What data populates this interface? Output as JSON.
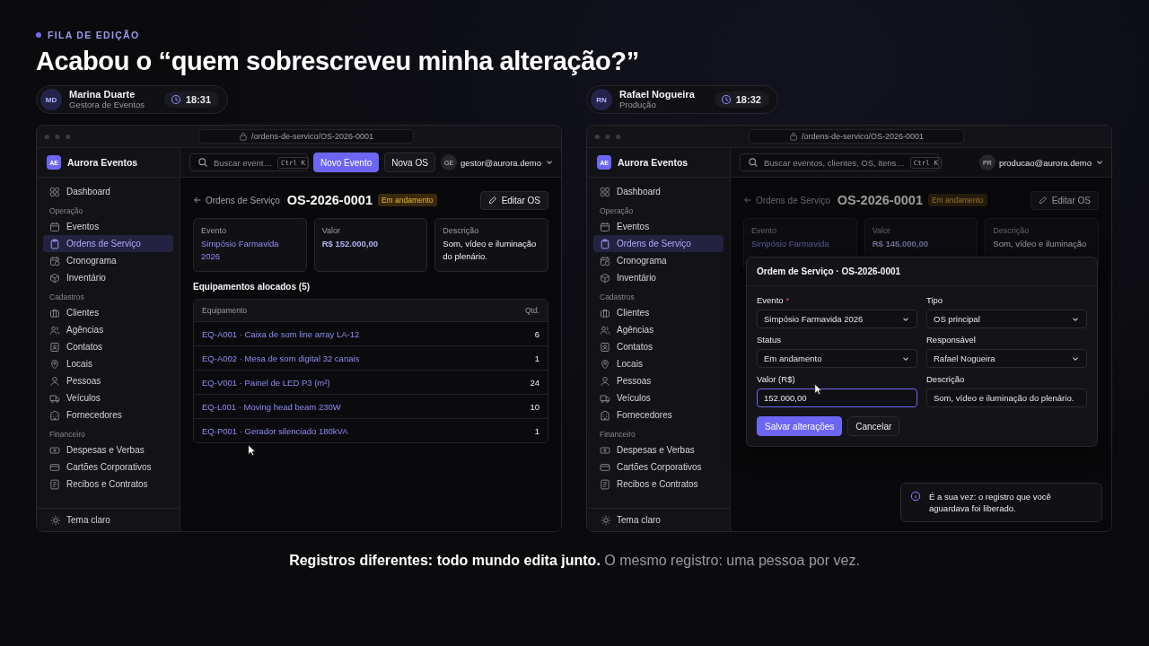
{
  "eyebrow": "FILA DE EDIÇÃO",
  "title": "Acabou o “quem sobrescreveu minha alteração?”",
  "panels": [
    {
      "user": {
        "initials": "MD",
        "name": "Marina Duarte",
        "role": "Gestora de Eventos",
        "time": "18:31"
      },
      "window": {
        "url": "/ordens-de-servico/OS-2026-0001",
        "brand_initials": "AE",
        "brand": "Aurora Eventos",
        "sidebar": [
          {
            "kind": "item",
            "label": "Dashboard",
            "selected": false
          },
          {
            "kind": "group",
            "label": "Operação"
          },
          {
            "kind": "item",
            "label": "Eventos",
            "selected": false
          },
          {
            "kind": "item",
            "label": "Ordens de Serviço",
            "selected": true
          },
          {
            "kind": "item",
            "label": "Cronograma",
            "selected": false
          },
          {
            "kind": "item",
            "label": "Inventário",
            "selected": false
          },
          {
            "kind": "group",
            "label": "Cadastros"
          },
          {
            "kind": "item",
            "label": "Clientes",
            "selected": false
          },
          {
            "kind": "item",
            "label": "Agências",
            "selected": false
          },
          {
            "kind": "item",
            "label": "Contatos",
            "selected": false
          },
          {
            "kind": "item",
            "label": "Locais",
            "selected": false
          },
          {
            "kind": "item",
            "label": "Pessoas",
            "selected": false
          },
          {
            "kind": "item",
            "label": "Veículos",
            "selected": false
          },
          {
            "kind": "item",
            "label": "Fornecedores",
            "selected": false
          },
          {
            "kind": "group",
            "label": "Financeiro"
          },
          {
            "kind": "item",
            "label": "Despesas e Verbas",
            "selected": false
          },
          {
            "kind": "item",
            "label": "Cartões Corporativos",
            "selected": false
          },
          {
            "kind": "item",
            "label": "Recibos e Contratos",
            "selected": false
          }
        ],
        "sidebar_footer": "Tema claro",
        "search": {
          "placeholder": "Buscar event…",
          "shortcut": "Ctrl K"
        },
        "actions": [
          {
            "label": "Novo Evento",
            "primary": true
          },
          {
            "label": "Nova OS",
            "primary": false
          }
        ],
        "account": {
          "initials": "GE",
          "email": "gestor@aurora.demo"
        },
        "page": {
          "back": "Ordens de Serviço",
          "title": "OS-2026-0001",
          "status": "Em andamento",
          "edit": "Editar OS",
          "cards": [
            {
              "label": "Evento",
              "value": "Simpósio Farmavida 2026",
              "kind": "link"
            },
            {
              "label": "Valor",
              "value": "R$ 152.000,00",
              "kind": "amount"
            },
            {
              "label": "Descrição",
              "value": "Som, vídeo e iluminação do plenário.",
              "kind": "text"
            }
          ],
          "equipment": {
            "title": "Equipamentos alocados (5)",
            "columns": [
              "Equipamento",
              "Qtd."
            ],
            "rows": [
              {
                "item": "EQ-A001 · Caixa de som line array LA-12",
                "qty": "6"
              },
              {
                "item": "EQ-A002 · Mesa de som digital 32 canais",
                "qty": "1"
              },
              {
                "item": "EQ-V001 · Painel de LED P3 (m²)",
                "qty": "24"
              },
              {
                "item": "EQ-L001 · Moving head beam 230W",
                "qty": "10"
              },
              {
                "item": "EQ-P001 · Gerador silenciado 180kVA",
                "qty": "1"
              }
            ]
          }
        }
      }
    },
    {
      "user": {
        "initials": "RN",
        "name": "Rafael Nogueira",
        "role": "Produção",
        "time": "18:32"
      },
      "window": {
        "url": "/ordens-de-servico/OS-2026-0001",
        "brand_initials": "AE",
        "brand": "Aurora Eventos",
        "sidebar": [
          {
            "kind": "item",
            "label": "Dashboard",
            "selected": false
          },
          {
            "kind": "group",
            "label": "Operação"
          },
          {
            "kind": "item",
            "label": "Eventos",
            "selected": false
          },
          {
            "kind": "item",
            "label": "Ordens de Serviço",
            "selected": true
          },
          {
            "kind": "item",
            "label": "Cronograma",
            "selected": false
          },
          {
            "kind": "item",
            "label": "Inventário",
            "selected": false
          },
          {
            "kind": "group",
            "label": "Cadastros"
          },
          {
            "kind": "item",
            "label": "Clientes",
            "selected": false
          },
          {
            "kind": "item",
            "label": "Agências",
            "selected": false
          },
          {
            "kind": "item",
            "label": "Contatos",
            "selected": false
          },
          {
            "kind": "item",
            "label": "Locais",
            "selected": false
          },
          {
            "kind": "item",
            "label": "Pessoas",
            "selected": false
          },
          {
            "kind": "item",
            "label": "Veículos",
            "selected": false
          },
          {
            "kind": "item",
            "label": "Fornecedores",
            "selected": false
          },
          {
            "kind": "group",
            "label": "Financeiro"
          },
          {
            "kind": "item",
            "label": "Despesas e Verbas",
            "selected": false
          },
          {
            "kind": "item",
            "label": "Cartões Corporativos",
            "selected": false
          },
          {
            "kind": "item",
            "label": "Recibos e Contratos",
            "selected": false
          }
        ],
        "sidebar_footer": "Tema claro",
        "search": {
          "placeholder": "Buscar eventos, clientes, OS, itens…",
          "shortcut": "Ctrl K"
        },
        "account": {
          "initials": "PR",
          "email": "producao@aurora.demo"
        },
        "page": {
          "back": "Ordens de Serviço",
          "title": "OS-2026-0001",
          "status": "Em andamento",
          "edit": "Editar OS",
          "cards": [
            {
              "label": "Evento",
              "value": "Simpósio Farmavida",
              "kind": "link"
            },
            {
              "label": "Valor",
              "value": "R$ 145.000,00",
              "kind": "amount"
            },
            {
              "label": "Descrição",
              "value": "Som, vídeo e iluminação",
              "kind": "text"
            }
          ]
        },
        "dialog": {
          "title": "Ordem de Serviço · OS-2026-0001",
          "fields": [
            {
              "label": "Evento",
              "marker": "*",
              "kind": "select",
              "value": "Simpósio Farmavida 2026",
              "focused": false
            },
            {
              "label": "Tipo",
              "kind": "select",
              "value": "OS principal",
              "focused": false
            },
            {
              "label": "Status",
              "kind": "select",
              "value": "Em andamento",
              "focused": false
            },
            {
              "label": "Responsável",
              "kind": "select",
              "value": "Rafael Nogueira",
              "focused": false
            },
            {
              "label": "Valor (R$)",
              "kind": "input",
              "value": "152.000,00",
              "focused": true
            },
            {
              "label": "Descrição",
              "kind": "input",
              "value": "Som, vídeo e iluminação do plenário.",
              "focused": false
            }
          ],
          "save": "Salvar alterações",
          "cancel": "Cancelar"
        },
        "toast": "É a sua vez: o registro que você aguardava foi liberado."
      }
    }
  ],
  "caption": "**Registros diferentes: todo mundo edita junto.** O mesmo registro: uma pessoa por vez."
}
